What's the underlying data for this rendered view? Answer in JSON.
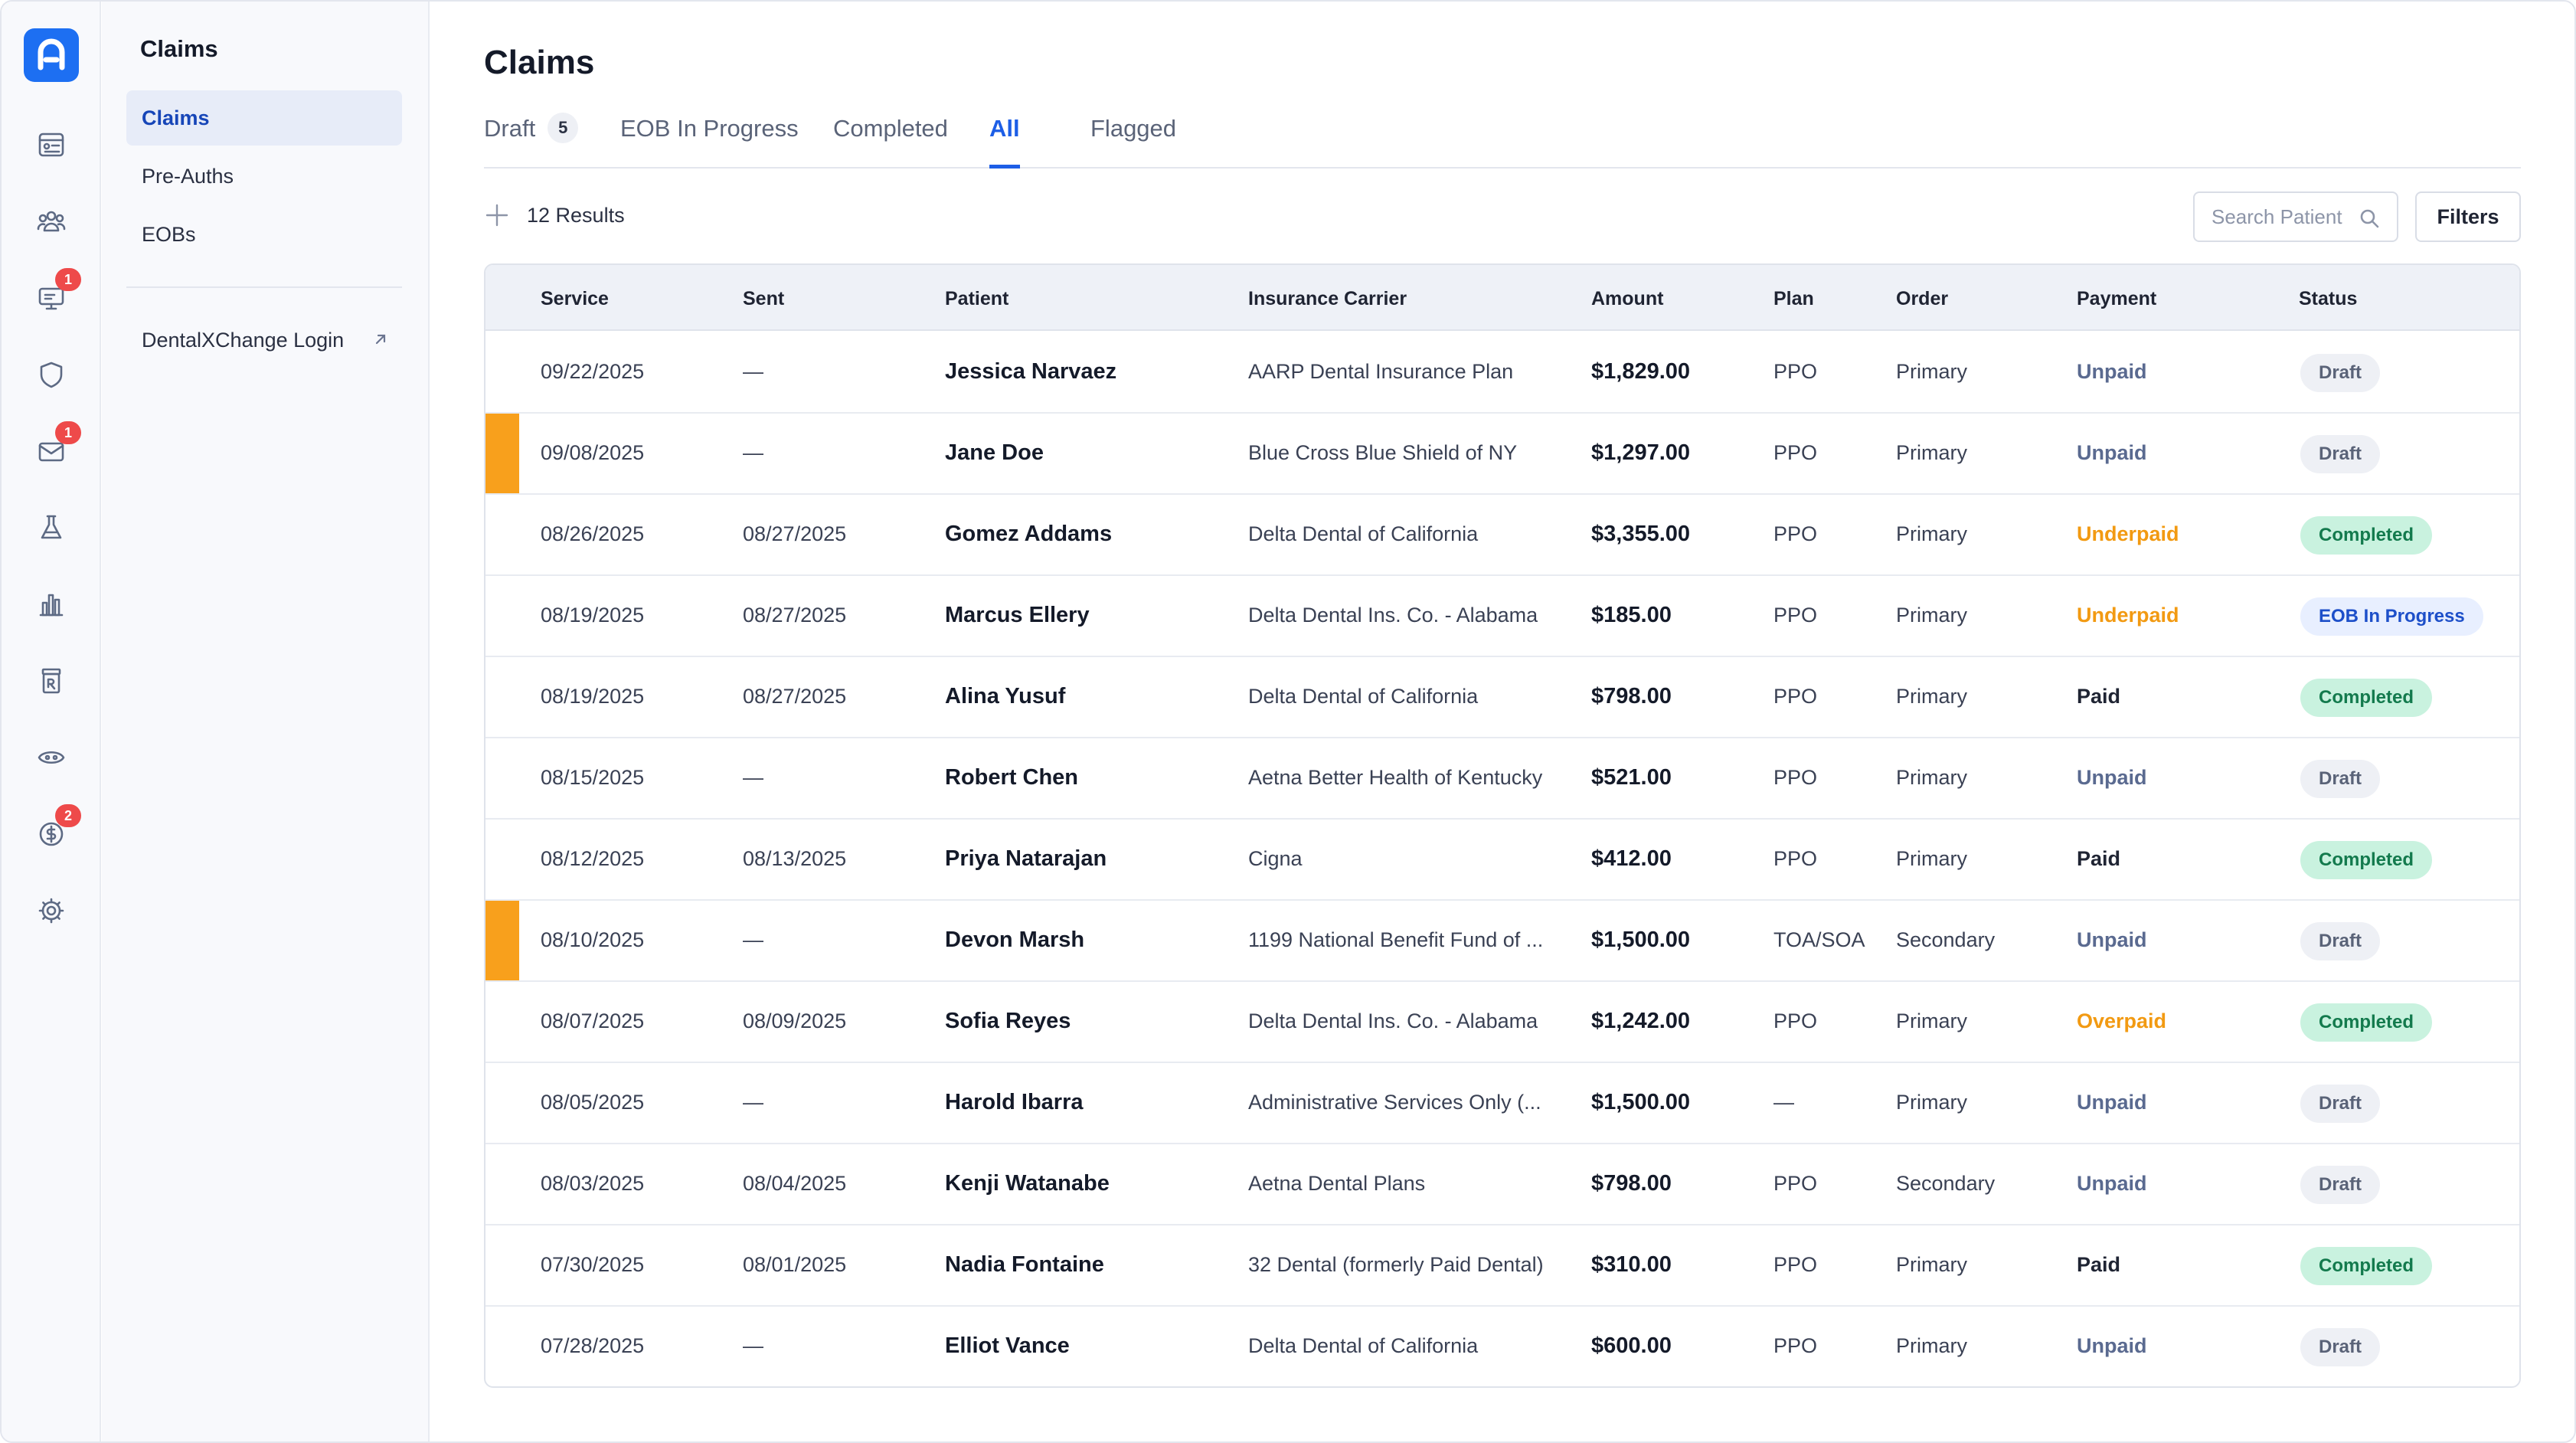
{
  "sidebar": {
    "rail_badges": {
      "chat": "1",
      "mail": "1",
      "billing": "2"
    },
    "section_title": "Claims",
    "items": [
      {
        "label": "Claims"
      },
      {
        "label": "Pre-Auths"
      },
      {
        "label": "EOBs"
      }
    ],
    "external_link": "DentalXChange Login"
  },
  "header": {
    "title": "Claims",
    "tabs": [
      {
        "label": "Draft",
        "count": "5"
      },
      {
        "label": "EOB In Progress"
      },
      {
        "label": "Completed"
      },
      {
        "label": "All"
      },
      {
        "label": "Flagged"
      }
    ]
  },
  "toolbar": {
    "results": "12 Results",
    "search_placeholder": "Search Patient",
    "filters_label": "Filters"
  },
  "table": {
    "columns": [
      "Service",
      "Sent",
      "Patient",
      "Insurance Carrier",
      "Amount",
      "Plan",
      "Order",
      "Payment",
      "Status"
    ],
    "rows": [
      {
        "service": "09/22/2025",
        "sent": "—",
        "patient": "Jessica Narvaez",
        "carrier": "AARP Dental Insurance Plan",
        "amount": "$1,829.00",
        "plan": "PPO",
        "order": "Primary",
        "payment": "Unpaid",
        "status": "Draft",
        "flagged": false
      },
      {
        "service": "09/08/2025",
        "sent": "—",
        "patient": "Jane Doe",
        "carrier": "Blue Cross Blue Shield of NY",
        "amount": "$1,297.00",
        "plan": "PPO",
        "order": "Primary",
        "payment": "Unpaid",
        "status": "Draft",
        "flagged": true
      },
      {
        "service": "08/26/2025",
        "sent": "08/27/2025",
        "patient": "Gomez Addams",
        "carrier": "Delta Dental of California",
        "amount": "$3,355.00",
        "plan": "PPO",
        "order": "Primary",
        "payment": "Underpaid",
        "status": "Completed",
        "flagged": false
      },
      {
        "service": "08/19/2025",
        "sent": "08/27/2025",
        "patient": "Marcus Ellery",
        "carrier": "Delta Dental Ins. Co. - Alabama",
        "amount": "$185.00",
        "plan": "PPO",
        "order": "Primary",
        "payment": "Underpaid",
        "status": "EOB In Progress",
        "flagged": false
      },
      {
        "service": "08/19/2025",
        "sent": "08/27/2025",
        "patient": "Alina Yusuf",
        "carrier": "Delta Dental of California",
        "amount": "$798.00",
        "plan": "PPO",
        "order": "Primary",
        "payment": "Paid",
        "status": "Completed",
        "flagged": false
      },
      {
        "service": "08/15/2025",
        "sent": "—",
        "patient": "Robert Chen",
        "carrier": "Aetna Better Health of Kentucky",
        "amount": "$521.00",
        "plan": "PPO",
        "order": "Primary",
        "payment": "Unpaid",
        "status": "Draft",
        "flagged": false
      },
      {
        "service": "08/12/2025",
        "sent": "08/13/2025",
        "patient": "Priya Natarajan",
        "carrier": "Cigna",
        "amount": "$412.00",
        "plan": "PPO",
        "order": "Primary",
        "payment": "Paid",
        "status": "Completed",
        "flagged": false
      },
      {
        "service": "08/10/2025",
        "sent": "—",
        "patient": "Devon Marsh",
        "carrier": "1199 National Benefit Fund of ...",
        "amount": "$1,500.00",
        "plan": "TOA/SOA",
        "order": "Secondary",
        "payment": "Unpaid",
        "status": "Draft",
        "flagged": true
      },
      {
        "service": "08/07/2025",
        "sent": "08/09/2025",
        "patient": "Sofia Reyes",
        "carrier": "Delta Dental Ins. Co. - Alabama",
        "amount": "$1,242.00",
        "plan": "PPO",
        "order": "Primary",
        "payment": "Overpaid",
        "status": "Completed",
        "flagged": false
      },
      {
        "service": "08/05/2025",
        "sent": "—",
        "patient": "Harold Ibarra",
        "carrier": "Administrative Services Only (...",
        "amount": "$1,500.00",
        "plan": "—",
        "order": "Primary",
        "payment": "Unpaid",
        "status": "Draft",
        "flagged": false
      },
      {
        "service": "08/03/2025",
        "sent": "08/04/2025",
        "patient": "Kenji Watanabe",
        "carrier": "Aetna Dental Plans",
        "amount": "$798.00",
        "plan": "PPO",
        "order": "Secondary",
        "payment": "Unpaid",
        "status": "Draft",
        "flagged": false
      },
      {
        "service": "07/30/2025",
        "sent": "08/01/2025",
        "patient": "Nadia Fontaine",
        "carrier": "32 Dental (formerly Paid Dental)",
        "amount": "$310.00",
        "plan": "PPO",
        "order": "Primary",
        "payment": "Paid",
        "status": "Completed",
        "flagged": false
      },
      {
        "service": "07/28/2025",
        "sent": "—",
        "patient": "Elliot Vance",
        "carrier": "Delta Dental of California",
        "amount": "$600.00",
        "plan": "PPO",
        "order": "Primary",
        "payment": "Unpaid",
        "status": "Draft",
        "flagged": false
      }
    ]
  },
  "colors": {
    "accent": "#1d5ee6",
    "flag": "#f8a01c",
    "completed_bg": "#c9f2df",
    "completed_text": "#137a4d",
    "warning_text": "#f29a12"
  }
}
